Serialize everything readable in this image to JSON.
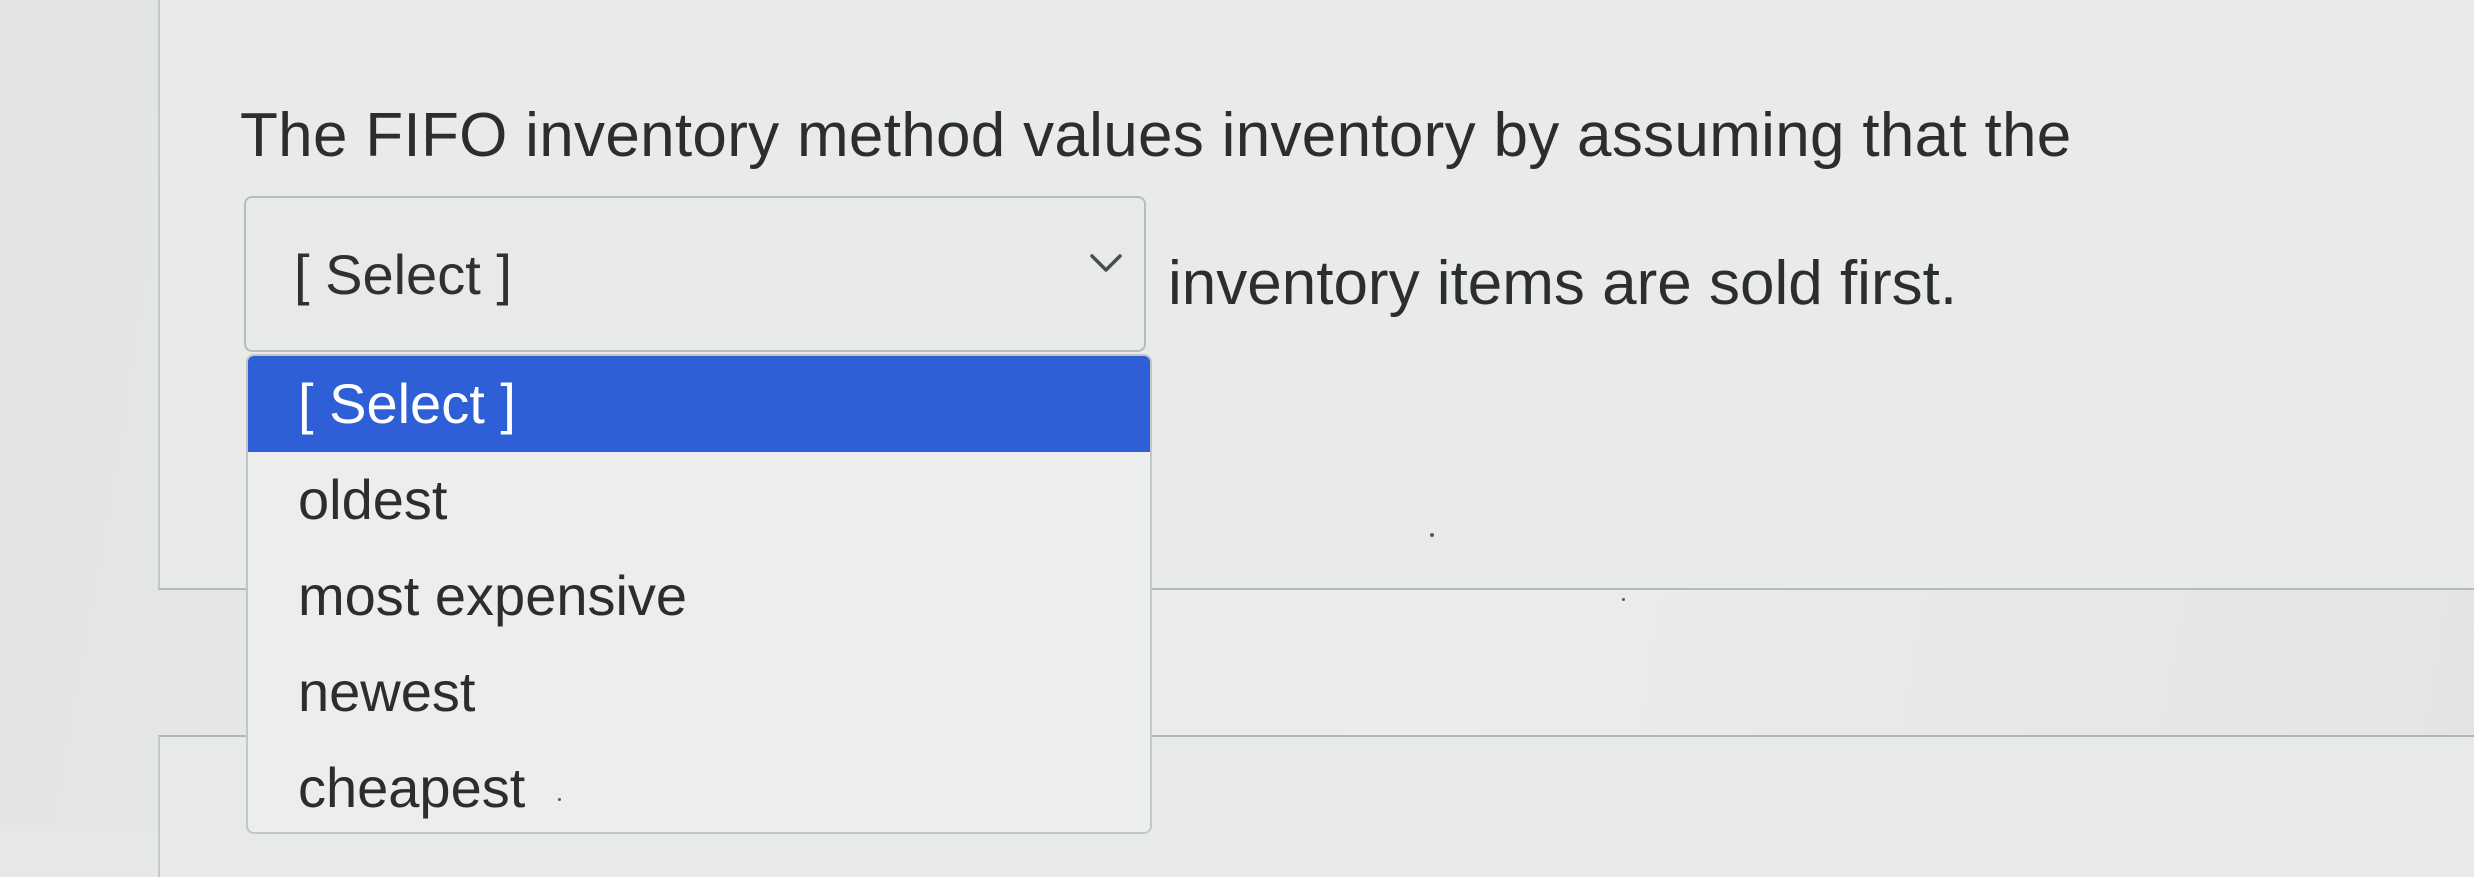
{
  "question": {
    "text_before": "The FIFO inventory method values inventory by assuming that the",
    "text_after": "inventory items are sold first."
  },
  "select": {
    "current_value": "[ Select ]",
    "icon": "chevron-down-icon",
    "options": [
      "[ Select ]",
      "oldest",
      "most expensive",
      "newest",
      "cheapest"
    ],
    "highlighted_index": 0
  },
  "colors": {
    "highlight": "#2f5fd6",
    "text": "#2b2d2f",
    "background": "#e9ebeb"
  }
}
